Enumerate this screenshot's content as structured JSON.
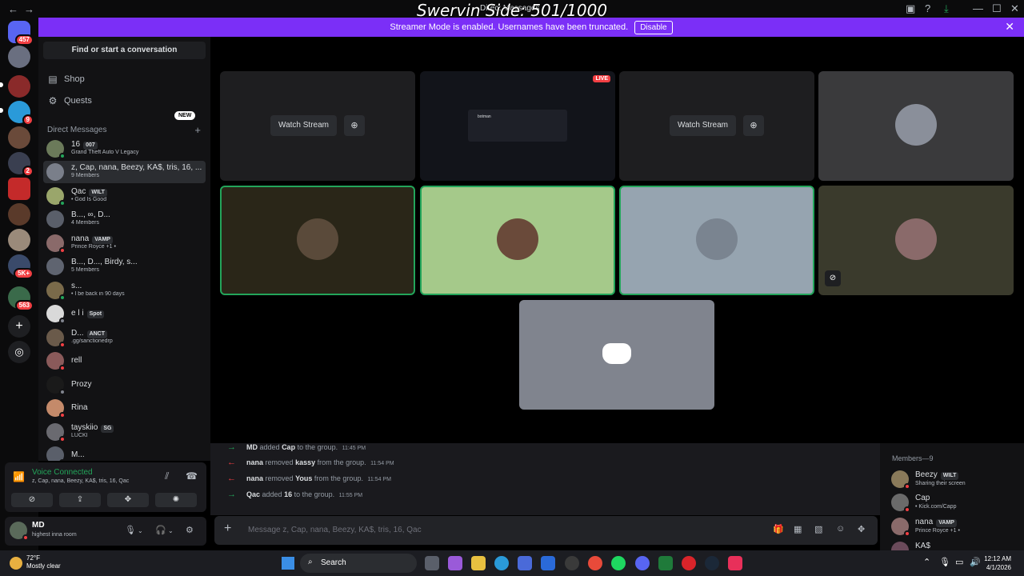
{
  "window": {
    "overlay_title": "Swervin Side: 501/1000",
    "title": "Direct Messages"
  },
  "banner": {
    "text": "Streamer Mode is enabled. Usernames have been truncated.",
    "button": "Disable"
  },
  "servers": {
    "home_badge": "457",
    "badges": [
      "9",
      "2",
      "5K+",
      "563"
    ]
  },
  "sidebar": {
    "search_placeholder": "Find or start a conversation",
    "shop": "Shop",
    "shop_badge": "NEW",
    "quests": "Quests",
    "dm_header": "Direct Messages",
    "dms": [
      {
        "name": "16",
        "tag": "007",
        "sub": "Grand Theft Auto V Legacy",
        "color": "#6b7a5a",
        "status": "#23a55a"
      },
      {
        "name": "z, Cap, nana, Beezy, KA$, tris, 16, ...",
        "sub": "9 Members",
        "color": "#7a7f8a",
        "status": ""
      },
      {
        "name": "Qac",
        "tag": "WILT",
        "sub": "• God Is Good",
        "color": "#9aa66b",
        "status": "#23a55a"
      },
      {
        "name": "B..., ∞, D...",
        "sub": "4 Members",
        "color": "#5a5f6a",
        "status": ""
      },
      {
        "name": "nana",
        "tag": "VAMP",
        "sub": "Prince Royce +1 •",
        "color": "#8a6a6a",
        "status": "#f23f43"
      },
      {
        "name": "B..., D..., Birdy, s...",
        "sub": "5 Members",
        "color": "#5f6470",
        "status": ""
      },
      {
        "name": "s...",
        "sub": "• I be back in 90 days",
        "color": "#7a6a4a",
        "status": "#23a55a"
      },
      {
        "name": "e l i",
        "tag": "Spot",
        "sub": "",
        "color": "#d9d9d9",
        "status": "#80848e"
      },
      {
        "name": "D...",
        "tag": "ANCT",
        "sub": ".gg/sanctionedrp",
        "color": "#6a5a4a",
        "status": "#f23f43"
      },
      {
        "name": "rell",
        "sub": "",
        "color": "#8a5a5a",
        "status": "#f23f43"
      },
      {
        "name": "Prozy",
        "sub": "",
        "color": "#1a1a1a",
        "status": "#80848e"
      },
      {
        "name": "Rina",
        "sub": "",
        "color": "#c48a6a",
        "status": "#f23f43"
      },
      {
        "name": "tayskiio",
        "tag": "SG",
        "sub": "LUCKI",
        "color": "#6a6a70",
        "status": "#f23f43"
      },
      {
        "name": "M...",
        "sub": "",
        "color": "#5a5f6a",
        "status": "#80848e"
      }
    ]
  },
  "voice": {
    "title": "Voice Connected",
    "channel": "z, Cap, nana, Beezy, KA$, tris, 16, Qac"
  },
  "user": {
    "name": "MD",
    "status": "highest inna room"
  },
  "stage": {
    "watch_label": "Watch Stream",
    "live_label": "LIVE",
    "stream_preview_title": "botman"
  },
  "chat": {
    "messages": [
      {
        "dir": "add",
        "actor": "MD",
        "verb": "added",
        "target": "Cap",
        "rest": "to the group.",
        "time": "11:45 PM"
      },
      {
        "dir": "remove",
        "actor": "nana",
        "verb": "removed",
        "target": "kassy",
        "rest": "from the group.",
        "time": "11:54 PM"
      },
      {
        "dir": "remove",
        "actor": "nana",
        "verb": "removed",
        "target": "Yous",
        "rest": "from the group.",
        "time": "11:54 PM"
      },
      {
        "dir": "add",
        "actor": "Qac",
        "verb": "added",
        "target": "16",
        "rest": "to the group.",
        "time": "11:55 PM"
      }
    ],
    "input_placeholder": "Message z, Cap, nana, Beezy, KA$, tris, 16, Qac"
  },
  "members": {
    "header": "Members—9",
    "list": [
      {
        "name": "Beezy",
        "tag": "WILT",
        "sub": "Sharing their screen",
        "color": "#8a7a5a"
      },
      {
        "name": "Cap",
        "sub": "• Kick.com/Capp",
        "color": "#6a6a6a"
      },
      {
        "name": "nana",
        "tag": "VAMP",
        "sub": "Prince Royce +1 •",
        "color": "#8a6a6a"
      },
      {
        "name": "KA$",
        "sub": "",
        "color": "#6a4a5a"
      }
    ]
  },
  "taskbar": {
    "temp": "72°F",
    "weather": "Mostly clear",
    "search": "Search",
    "time": "12:12 AM",
    "date": "4/1/2026"
  }
}
